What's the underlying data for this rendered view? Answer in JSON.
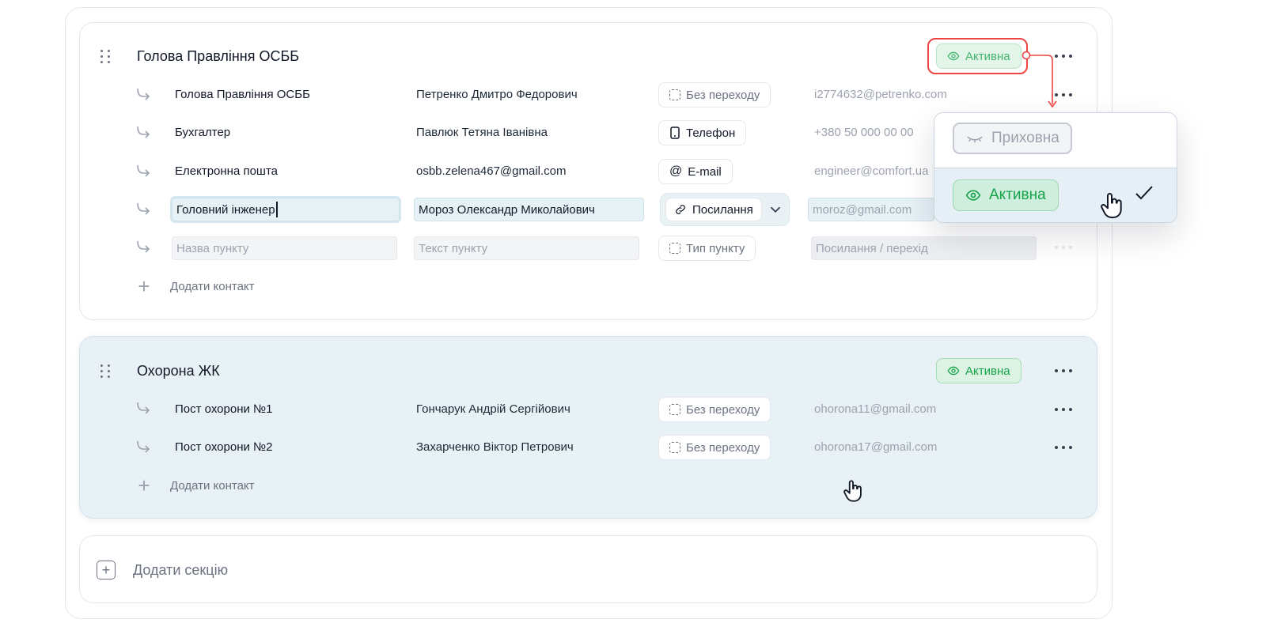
{
  "sections": [
    {
      "title": "Голова Правління ОСББ",
      "status": "Активна",
      "rows": [
        {
          "name": "Голова Правління ОСББ",
          "person": "Петренко Дмитро Федорович",
          "type": "Без переходу",
          "link": "i2774632@petrenko.com"
        },
        {
          "name": "Бухгалтер",
          "person": "Павлюк Тетяна Іванівна",
          "type": "Телефон",
          "link": "+380 50 000 00 00"
        },
        {
          "name": "Електронна пошта",
          "person": "osbb.zelena467@gmail.com",
          "type": "E-mail",
          "link": "engineer@comfort.ua"
        },
        {
          "name": "Головний інженер",
          "person": "Мороз Олександр Миколайович",
          "type": "Посилання",
          "link": "moroz@gmail.com"
        }
      ],
      "new_row": {
        "name_placeholder": "Назва пункту",
        "person_placeholder": "Текст пункту",
        "type_placeholder": "Тип пункту",
        "link_placeholder": "Посилання / перехід"
      },
      "add_contact": "Додати контакт"
    },
    {
      "title": "Охорона ЖК",
      "status": "Активна",
      "rows": [
        {
          "name": "Пост охорони №1",
          "person": "Гончарук Андрій Сергійович",
          "type": "Без переходу",
          "link": "ohorona11@gmail.com"
        },
        {
          "name": "Пост охорони №2",
          "person": "Захарченко Віктор Петрович",
          "type": "Без переходу",
          "link": "ohorona17@gmail.com"
        }
      ],
      "add_contact": "Додати контакт"
    }
  ],
  "add_section": "Додати секцію",
  "status_dropdown": {
    "options": [
      "Приховна",
      "Активна"
    ],
    "selected": "Активна"
  },
  "colors": {
    "active_green": "#16a34a",
    "active_bg": "#dcf3e4",
    "highlight_red": "#ef4444",
    "section_selected_bg": "#e8f1f6"
  },
  "icons": [
    "drag-handle-icon",
    "eye-icon",
    "more-icon",
    "subitem-arrow-icon",
    "no-link-icon",
    "phone-icon",
    "at-icon",
    "link-icon",
    "chevron-down-icon",
    "plus-icon",
    "eye-closed-icon",
    "check-icon",
    "hand-cursor-icon"
  ]
}
